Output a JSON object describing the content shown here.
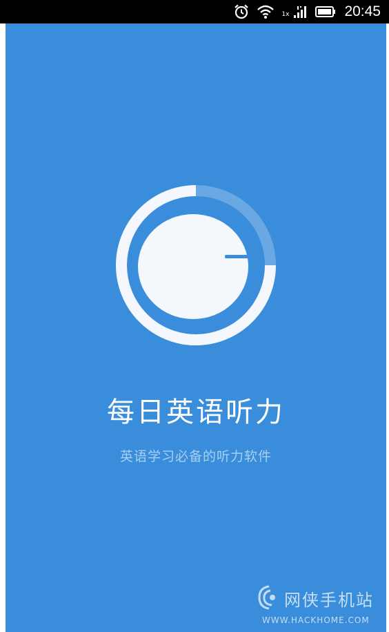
{
  "status_bar": {
    "network_type": "1x",
    "time": "20:45",
    "icons": [
      "alarm-icon",
      "wifi-icon",
      "signal-icon",
      "battery-icon"
    ]
  },
  "splash": {
    "app_name": "每日英语听力",
    "tagline": "英语学习必备的听力软件"
  },
  "watermark": {
    "name": "网侠手机站",
    "url": "WWW.HACKHOME.COM"
  },
  "colors": {
    "background": "#3a8ddb",
    "logo": "#f4f7fb",
    "logo_arc": "#6aa8e4",
    "tagline": "#a8d0f3",
    "status_bar": "#000000"
  }
}
